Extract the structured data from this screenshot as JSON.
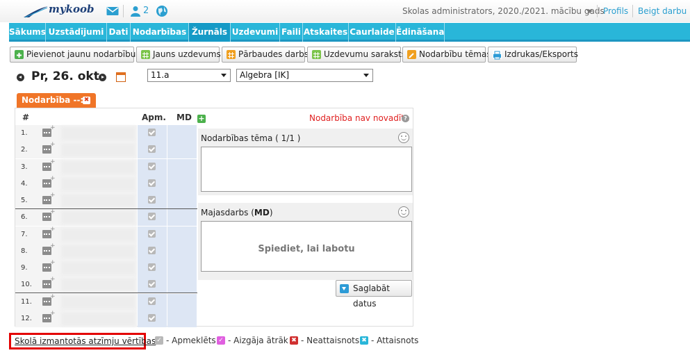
{
  "header": {
    "logo_text": "mykoob",
    "messages_icon": "envelope-icon",
    "users_icon": "users-icon",
    "online_count": "2",
    "language_icon": "globe-icon",
    "role": "Skolas administrators, 2020./2021. mācību gads",
    "profile_label": "Profils",
    "logout_label": "Beigt darbu"
  },
  "nav": {
    "items": [
      {
        "label": "Sākums"
      },
      {
        "label": "Uzstādījumi"
      },
      {
        "label": "Dati"
      },
      {
        "label": "Nodarbības"
      },
      {
        "label": "Žurnāls",
        "active": true
      },
      {
        "label": "Uzdevumi"
      },
      {
        "label": "Faili"
      },
      {
        "label": "Atskaites"
      },
      {
        "label": "Caurlaide"
      },
      {
        "label": "Ēdināšana"
      }
    ]
  },
  "toolbar": {
    "buttons": [
      {
        "label": "Pievienot jaunu nodarbību",
        "icon": "add-icon",
        "color": "#4cb14c"
      },
      {
        "label": "Jauns uzdevums",
        "icon": "grid-icon",
        "color": "#7cc44a"
      },
      {
        "label": "Pārbaudes darbs",
        "icon": "grid-icon",
        "color": "#f0a020"
      },
      {
        "label": "Uzdevumu saraksts",
        "icon": "grid-icon",
        "color": "#7cc44a"
      },
      {
        "label": "Nodarbību tēmas",
        "icon": "edit-icon",
        "color": "#f0a020"
      },
      {
        "label": "Izdrukas/Eksports",
        "icon": "print-icon",
        "color": "#2d9bd6"
      }
    ]
  },
  "date_bar": {
    "date": "Pr, 26. okt.",
    "class_value": "11.a",
    "subject_value": "Algebra [IK]"
  },
  "lesson_tab": {
    "label": "Nodarbība --:--"
  },
  "table": {
    "header_num": "#",
    "header_apm": "Apm.",
    "header_md": "MD",
    "rows": [
      {
        "num": "1."
      },
      {
        "num": "2."
      },
      {
        "num": "3."
      },
      {
        "num": "4."
      },
      {
        "num": "5."
      },
      {
        "num": "6."
      },
      {
        "num": "7."
      },
      {
        "num": "8."
      },
      {
        "num": "9."
      },
      {
        "num": "10."
      },
      {
        "num": "11."
      },
      {
        "num": "12."
      }
    ]
  },
  "lesson_panel": {
    "status": "Nodarbība nav novadīta",
    "topic_title": "Nodarbības tēma ( 1/1 )",
    "homework_title_prefix": "Majasdarbs (",
    "homework_title_bold": "MD",
    "homework_title_suffix": ")",
    "homework_placeholder": "Spiediet, lai labotu",
    "save_label": "Saglabāt datus"
  },
  "legend": {
    "link_label": "Skolā izmantotās atzīmju vērtības",
    "items": [
      {
        "label": "- Apmeklēts",
        "color": "#b8b8b8",
        "symbol": "✓"
      },
      {
        "label": "- Aizgāja ātrāk",
        "color": "#e060e0",
        "symbol": "✓"
      },
      {
        "label": "- Neattaisnots",
        "color": "#d03030",
        "symbol": "✖"
      },
      {
        "label": "- Attaisnots",
        "color": "#29b6d9",
        "symbol": "✖"
      }
    ]
  }
}
